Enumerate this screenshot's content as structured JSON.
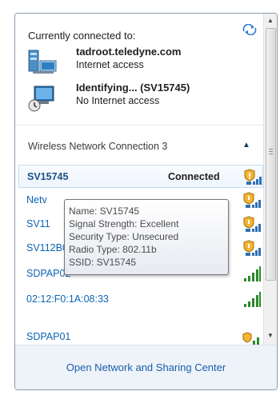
{
  "header": {
    "title": "Currently connected to:",
    "refresh_icon": "refresh-icon"
  },
  "connections": [
    {
      "name": "tadroot.teledyne.com",
      "status": "Internet access",
      "icon": "domain-network-icon"
    },
    {
      "name": "Identifying... (SV15745)",
      "status": "No Internet access",
      "icon": "identifying-network-icon"
    }
  ],
  "section": {
    "label": "Wireless Network Connection 3",
    "collapse_icon": "chevron-up-icon"
  },
  "networks": [
    {
      "label": "SV15745",
      "status": "Connected",
      "signal": "unsecured-shield-icon"
    },
    {
      "label": "Netv",
      "signal": "unsecured-shield-icon"
    },
    {
      "label": "SV11",
      "signal": "unsecured-shield-icon"
    },
    {
      "label": "SV112B0",
      "signal": "unsecured-shield-icon"
    },
    {
      "label": "SDPAP02",
      "signal": "signal-bars-icon"
    },
    {
      "label": "02:12:F0:1A:08:33",
      "signal": "signal-bars-icon"
    },
    {
      "label": "SDPAP01",
      "signal": "unsecured-signal-icon"
    }
  ],
  "tooltip": {
    "name": "Name: SV15745",
    "signal": "Signal Strength: Excellent",
    "security": "Security Type: Unsecured",
    "radio": "Radio Type: 802.11b",
    "ssid": "SSID: SV15745"
  },
  "footer": {
    "link": "Open Network and Sharing Center"
  },
  "colors": {
    "link": "#0d64b5",
    "selected_bg": "#eef5fd",
    "footer_bg": "#eef3fa"
  }
}
